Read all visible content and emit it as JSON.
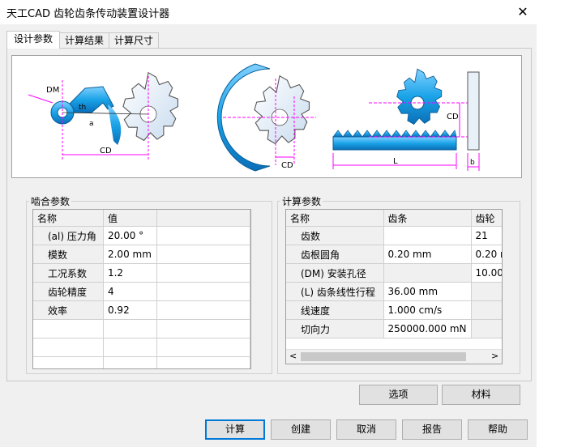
{
  "window": {
    "title": "天工CAD 齿轮齿条传动装置设计器",
    "close_symbol": "✕"
  },
  "tabs": [
    "设计参数",
    "计算结果",
    "计算尺寸"
  ],
  "diagram": {
    "labels": {
      "dm": "DM",
      "th": "th",
      "a": "a",
      "cd1": "CD",
      "cd2": "CD",
      "cd3": "CD",
      "l": "L",
      "b": "b"
    }
  },
  "mesh_params": {
    "title": "啮合参数",
    "columns": [
      "名称",
      "值"
    ],
    "rows": [
      {
        "name": "(al) 压力角",
        "value": "20.00 °"
      },
      {
        "name": "模数",
        "value": "2.00 mm"
      },
      {
        "name": "工况系数",
        "value": "1.2"
      },
      {
        "name": "齿轮精度",
        "value": "4"
      },
      {
        "name": "效率",
        "value": "0.92"
      }
    ]
  },
  "calc_params": {
    "title": "计算参数",
    "columns": [
      "名称",
      "齿条",
      "齿轮"
    ],
    "rows": [
      {
        "name": "齿数",
        "rack": "",
        "gear": "21"
      },
      {
        "name": "齿根圆角",
        "rack": "0.20 mm",
        "gear": "0.20 n"
      },
      {
        "name": "(DM) 安装孔径",
        "rack": "",
        "gear": "10.00"
      },
      {
        "name": "(L) 齿条线性行程",
        "rack": "36.00 mm",
        "gear": ""
      },
      {
        "name": "线速度",
        "rack": "1.000 cm/s",
        "gear": ""
      },
      {
        "name": "切向力",
        "rack": "250000.000 mN",
        "gear": ""
      }
    ],
    "scroll_left": "<",
    "scroll_right": ">"
  },
  "buttons": {
    "options": "选项",
    "material": "材料",
    "calculate": "计算",
    "create": "创建",
    "cancel": "取消",
    "report": "报告",
    "help": "帮助"
  },
  "colors": {
    "gear_blue": "#1aa3e8",
    "gear_light": "#eef4fb",
    "dimension": "#ff00ff",
    "accent": "#0078d7"
  }
}
